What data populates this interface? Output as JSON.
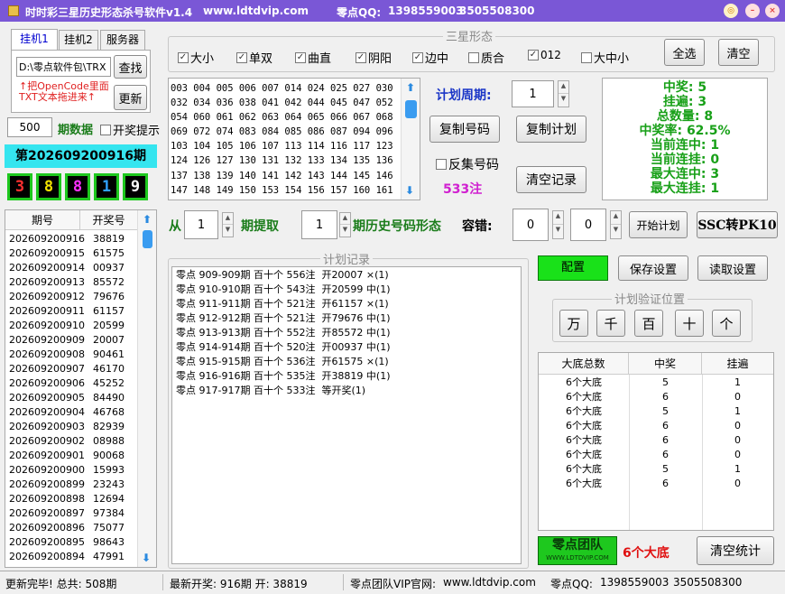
{
  "window": {
    "title": "时时彩三星历史形态杀号软件v1.4",
    "site": "www.ldtdvip.com",
    "qq_label": "零点QQ:",
    "qq1": "1398559003",
    "qq2": "3505508300"
  },
  "tabs": [
    "挂机1",
    "挂机2",
    "服务器"
  ],
  "path": {
    "value": "D:\\零点软件包\\TRX",
    "find_btn": "查找",
    "hint1": "↑把OpenCode里面",
    "hint2": "TXT文本拖进来↑",
    "update_btn": "更新"
  },
  "period_count": {
    "value": "500",
    "label": "期数据",
    "prize_hint": "开奖提示"
  },
  "current_issue": {
    "label": "第202609200916期",
    "digits": [
      "3",
      "8",
      "8",
      "1",
      "9"
    ]
  },
  "history": {
    "headers": [
      "期号",
      "开奖号"
    ],
    "rows": [
      [
        "202609200916",
        "38819"
      ],
      [
        "202609200915",
        "61575"
      ],
      [
        "202609200914",
        "00937"
      ],
      [
        "202609200913",
        "85572"
      ],
      [
        "202609200912",
        "79676"
      ],
      [
        "202609200911",
        "61157"
      ],
      [
        "202609200910",
        "20599"
      ],
      [
        "202609200909",
        "20007"
      ],
      [
        "202609200908",
        "90461"
      ],
      [
        "202609200907",
        "46170"
      ],
      [
        "202609200906",
        "45252"
      ],
      [
        "202609200905",
        "84490"
      ],
      [
        "202609200904",
        "46768"
      ],
      [
        "202609200903",
        "82939"
      ],
      [
        "202609200902",
        "08988"
      ],
      [
        "202609200901",
        "90068"
      ],
      [
        "202609200900",
        "15993"
      ],
      [
        "202609200899",
        "23243"
      ],
      [
        "202609200898",
        "12694"
      ],
      [
        "202609200897",
        "97384"
      ],
      [
        "202609200896",
        "75077"
      ],
      [
        "202609200895",
        "98643"
      ],
      [
        "202609200894",
        "47991"
      ]
    ]
  },
  "sanxing": {
    "title": "三星形态",
    "options": [
      {
        "label": "大小",
        "checked": true
      },
      {
        "label": "单双",
        "checked": true
      },
      {
        "label": "曲直",
        "checked": true
      },
      {
        "label": "阴阳",
        "checked": true
      },
      {
        "label": "边中",
        "checked": true
      },
      {
        "label": "质合",
        "checked": false
      },
      {
        "label": "012",
        "checked": true
      },
      {
        "label": "大中小",
        "checked": false
      }
    ],
    "select_all": "全选",
    "clear": "清空"
  },
  "numbers": {
    "lines": [
      "003 004 005 006 007 014 024 025 027 030",
      "032 034 036 038 041 042 044 045 047 052",
      "054 060 061 062 063 064 065 066 067 068",
      "069 072 074 083 084 085 086 087 094 096",
      "103 104 105 106 107 113 114 116 117 123",
      "124 126 127 130 131 132 133 134 135 136",
      "137 138 139 140 141 142 143 144 145 146",
      "147 148 149 150 153 154 156 157 160 161"
    ]
  },
  "plan": {
    "cycle_label": "计划周期:",
    "cycle_value": "1",
    "copy_numbers": "复制号码",
    "copy_plan": "复制计划",
    "reverse": "反集号码",
    "count_note": "533注",
    "clear_record": "清空记录"
  },
  "stats": {
    "lines": [
      "中奖: 5",
      "挂遍: 3",
      "总数量: 8",
      "中奖率: 62.5%",
      "当前连中: 1",
      "当前连挂: 0",
      "最大连中: 3",
      "最大连挂: 1"
    ]
  },
  "extract": {
    "from": "从",
    "from_value": "1",
    "period_take": "期提取",
    "hist_value": "1",
    "hist_label": "期历史号码形态",
    "tolerance": "容错:",
    "tol1": "0",
    "tol2": "0",
    "start_plan": "开始计划",
    "ssc_pk10": "SSC转PK10"
  },
  "records": {
    "title": "计划记录",
    "lines": [
      "零点 909-909期 百十个 556注  开20007 ×(1)",
      "零点 910-910期 百十个 543注  开20599 中(1)",
      "零点 911-911期 百十个 521注  开61157 ×(1)",
      "零点 912-912期 百十个 521注  开79676 中(1)",
      "零点 913-913期 百十个 552注  开85572 中(1)",
      "零点 914-914期 百十个 520注  开00937 中(1)",
      "零点 915-915期 百十个 536注  开61575 ×(1)",
      "零点 916-916期 百十个 535注  开38819 中(1)",
      "零点 917-917期 百十个 533注  等开奖(1)"
    ]
  },
  "settings": {
    "config": "配置",
    "save": "保存设置",
    "read": "读取设置"
  },
  "verify": {
    "title": "计划验证位置",
    "positions": [
      "万",
      "千",
      "百",
      "十",
      "个"
    ]
  },
  "bottom_table": {
    "headers": [
      "大底总数",
      "中奖",
      "挂遍"
    ],
    "rows": [
      [
        "6个大底",
        "5",
        "1"
      ],
      [
        "6个大底",
        "6",
        "0"
      ],
      [
        "6个大底",
        "5",
        "1"
      ],
      [
        "6个大底",
        "6",
        "0"
      ],
      [
        "6个大底",
        "6",
        "0"
      ],
      [
        "6个大底",
        "6",
        "0"
      ],
      [
        "6个大底",
        "5",
        "1"
      ],
      [
        "6个大底",
        "6",
        "0"
      ]
    ]
  },
  "team": {
    "logo_text": "零点团队",
    "logo_url": "WWW.LDTDVIP.COM",
    "dadi": "6个大底",
    "clear_stats": "清空统计"
  },
  "status": {
    "left": "更新完毕! 总共: 508期",
    "mid": "最新开奖: 916期 开: 38819",
    "vip_label": "零点团队VIP官网:",
    "vip_url": "www.ldtdvip.com",
    "qq_label": "零点QQ:",
    "qq1": "1398559003",
    "qq2": "3505508300"
  },
  "colors": {
    "title_bg": "#7a57d6",
    "stats_green": "#18a018",
    "plan_blue": "#1b36c7",
    "green_label": "#1a7c1a",
    "magenta": "#d020d0",
    "issue_bg": "#35e5ef"
  }
}
